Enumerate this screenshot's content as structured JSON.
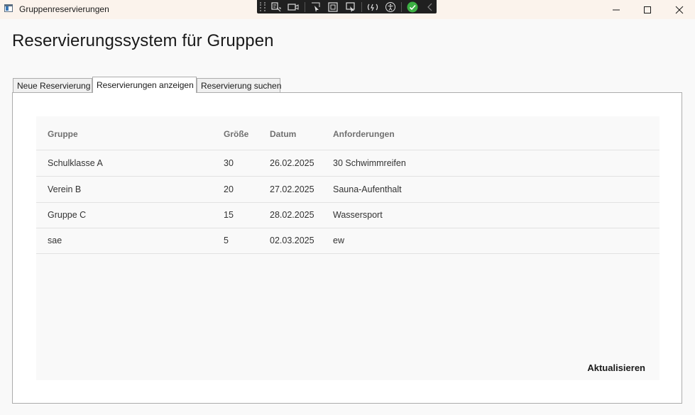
{
  "window": {
    "title": "Gruppenreservierungen"
  },
  "header": {
    "title": "Reservierungssystem für Gruppen"
  },
  "tabs": [
    {
      "label": "Neue Reservierung",
      "active": false
    },
    {
      "label": "Reservierungen anzeigen",
      "active": true
    },
    {
      "label": "Reservierung suchen",
      "active": false
    }
  ],
  "table": {
    "columns": [
      "Gruppe",
      "Größe",
      "Datum",
      "Anforderungen"
    ],
    "rows": [
      [
        "Schulklasse A",
        "30",
        "26.02.2025",
        "30 Schwimmreifen"
      ],
      [
        "Verein B",
        "20",
        "27.02.2025",
        "Sauna-Aufenthalt"
      ],
      [
        "Gruppe C",
        "15",
        "28.02.2025",
        "Wassersport"
      ],
      [
        "sae",
        "5",
        "02.03.2025",
        "ew"
      ]
    ]
  },
  "actions": {
    "refresh_label": "Aktualisieren"
  },
  "devtoolbar": {
    "icons": [
      "live-visual-tree-icon",
      "record-icon",
      "select-element-icon",
      "display-layout-adorners-icon",
      "track-focus-icon",
      "hot-reload-icon",
      "accessibility-icon",
      "binding-ok-icon",
      "collapse-icon"
    ]
  },
  "colors": {
    "titlebar_bg": "#fbf3ec",
    "devbar_bg": "#202020",
    "accent_ok": "#3cb043"
  }
}
